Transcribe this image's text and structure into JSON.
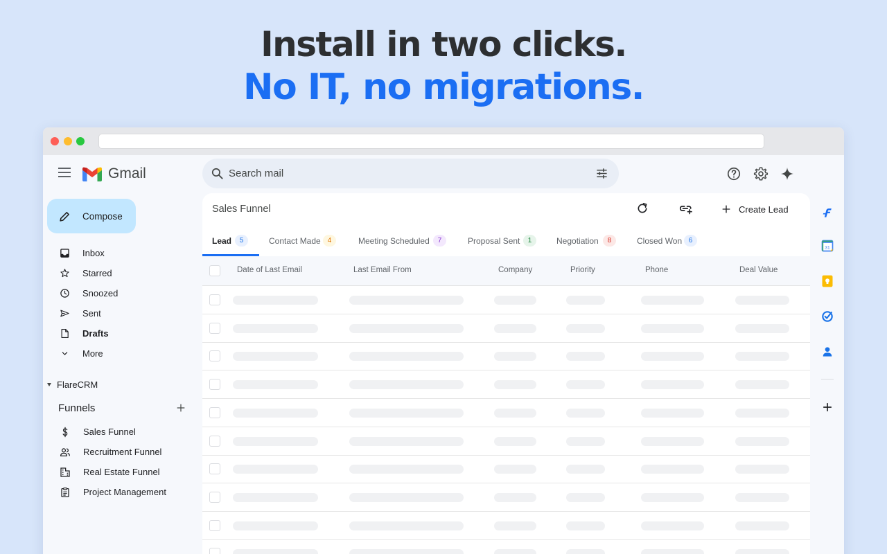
{
  "headline": {
    "line1": "Install in two clicks.",
    "line2": "No IT, no migrations."
  },
  "gmail": {
    "brand": "Gmail",
    "search_placeholder": "Search mail",
    "compose_label": "Compose",
    "nav": [
      {
        "label": "Inbox",
        "icon": "inbox-icon"
      },
      {
        "label": "Starred",
        "icon": "star-icon"
      },
      {
        "label": "Snoozed",
        "icon": "clock-icon"
      },
      {
        "label": "Sent",
        "icon": "send-icon"
      },
      {
        "label": "Drafts",
        "icon": "draft-icon"
      },
      {
        "label": "More",
        "icon": "chevron-down-icon"
      }
    ]
  },
  "crm": {
    "section_label": "FlareCRM",
    "funnels_title": "Funnels",
    "funnels": [
      {
        "label": "Sales Funnel",
        "icon": "dollar-icon"
      },
      {
        "label": "Recruitment Funnel",
        "icon": "people-icon"
      },
      {
        "label": "Real Estate Funnel",
        "icon": "building-icon"
      },
      {
        "label": "Project Management",
        "icon": "clipboard-icon"
      }
    ]
  },
  "panel": {
    "title": "Sales Funnel",
    "create_label": "Create Lead",
    "tabs": [
      {
        "label": "Lead",
        "count": "5",
        "badge_bg": "#e8f0fe",
        "badge_fg": "#1a73e8"
      },
      {
        "label": "Contact Made",
        "count": "4",
        "badge_bg": "#fef7e0",
        "badge_fg": "#e37400"
      },
      {
        "label": "Meeting Scheduled",
        "count": "7",
        "badge_bg": "#f3e8fd",
        "badge_fg": "#8430ce"
      },
      {
        "label": "Proposal Sent",
        "count": "1",
        "badge_bg": "#e6f4ea",
        "badge_fg": "#188038"
      },
      {
        "label": "Negotiation",
        "count": "8",
        "badge_bg": "#fce8e6",
        "badge_fg": "#d93025"
      },
      {
        "label": "Closed Won",
        "count": "6",
        "badge_bg": "#e8f0fe",
        "badge_fg": "#1a73e8"
      }
    ],
    "columns": [
      "Date of Last Email",
      "Last Email From",
      "Company",
      "Priority",
      "Phone",
      "Deal Value"
    ]
  },
  "colors": {
    "accent": "#1b6ef3",
    "compose_bg": "#c2e7ff",
    "page_bg": "#d7e5fa"
  },
  "rail_icons": [
    "flarecrm-icon",
    "calendar-icon",
    "keep-icon",
    "tasks-icon",
    "contacts-icon",
    "add-icon"
  ]
}
